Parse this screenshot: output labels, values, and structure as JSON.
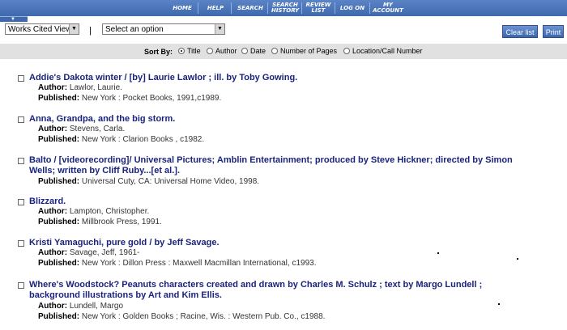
{
  "nav": [
    {
      "label": "HOME"
    },
    {
      "label": "HELP"
    },
    {
      "label": "SEARCH"
    },
    {
      "label": "SEARCH HISTORY"
    },
    {
      "label": "REVIEW LIST"
    },
    {
      "label": "LOG ON"
    },
    {
      "label": "MY ACCOUNT"
    }
  ],
  "toolbar": {
    "view_select": "Works Cited View",
    "separator": "|",
    "option_select": "Select an option",
    "clear_list": "Clear list",
    "print": "Print"
  },
  "sort": {
    "label": "Sort By:",
    "options": [
      {
        "label": "Title",
        "selected": true
      },
      {
        "label": "Author",
        "selected": false
      },
      {
        "label": "Date",
        "selected": false
      },
      {
        "label": "Number of Pages",
        "selected": false
      },
      {
        "label": "Location/Call Number",
        "selected": false
      }
    ]
  },
  "field_labels": {
    "author": "Author:",
    "published": "Published:"
  },
  "records": [
    {
      "title": "Addie's Dakota winter / [by] Laurie Lawlor ; ill. by Toby Gowing.",
      "author": "Lawlor, Laurie.",
      "published": "New York : Pocket Books, 1991,c1989."
    },
    {
      "title": "Anna, Grandpa, and the big storm.",
      "author": "Stevens, Carla.",
      "published": "New York : Clarion Books , c1982."
    },
    {
      "title": "Balto / [videorecording]/ Universal Pictures; Amblin Entertainment; produced by Steve Hickner; directed by Simon Wells; written by Cliff Ruby...[et al.].",
      "published": "Universal Cuty, CA: Universal Home Video, 1998."
    },
    {
      "title": "Blizzard.",
      "author": "Lampton, Christopher.",
      "published": "Millbrook Press, 1991."
    },
    {
      "title": "Kristi Yamaguchi, pure gold / by Jeff Savage.",
      "author": "Savage, Jeff, 1961-",
      "published": "New York : Dillon Press : Maxwell Macmillan International, c1993."
    },
    {
      "title": "Where's Woodstock? Peanuts characters created and drawn by Charles M. Schulz ; text by Margo Lundell ; background illustrations by Art and Kim Ellis.",
      "author": "Lundell, Margo",
      "published": "New York : Golden Books ; Racine, Wis. : Western Pub. Co., c1988."
    }
  ]
}
